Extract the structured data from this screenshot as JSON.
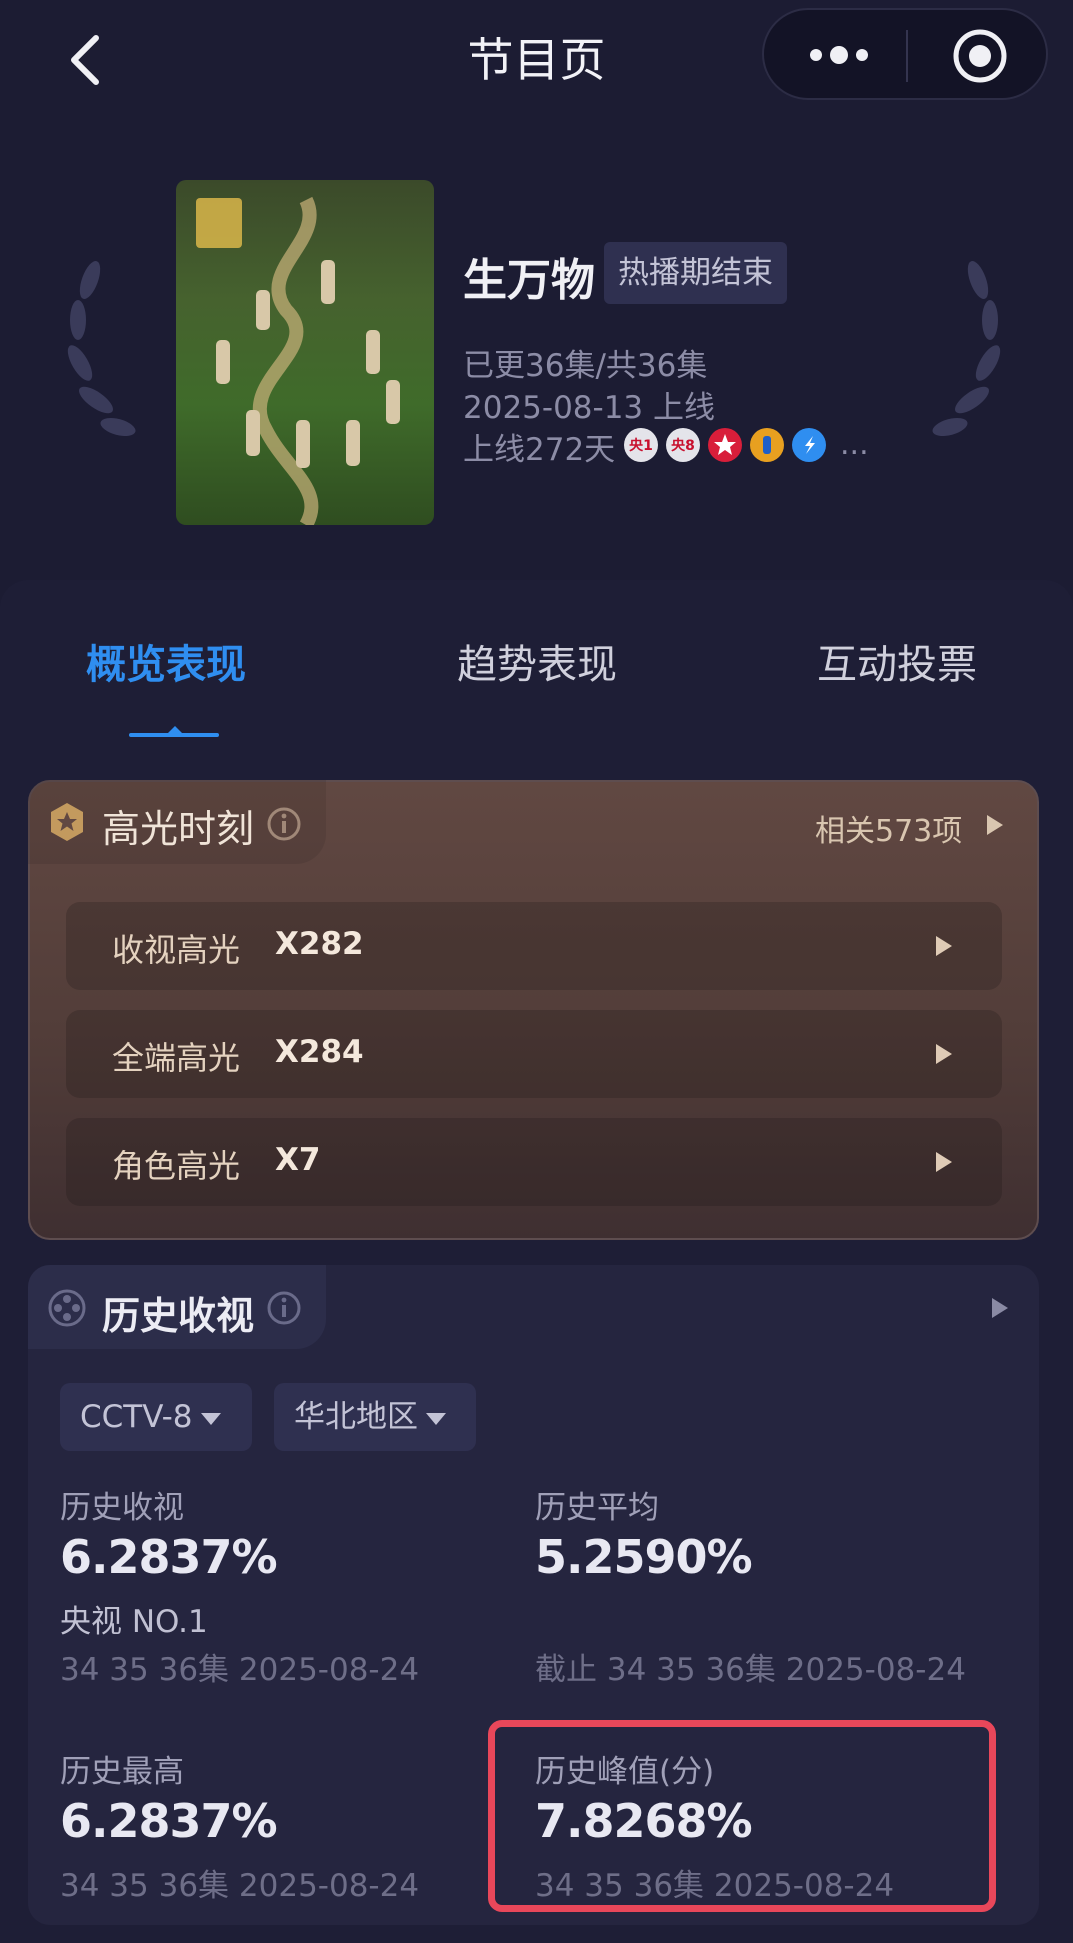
{
  "nav": {
    "title": "节目页",
    "back_icon": "back-chevron-icon",
    "more_icon": "more-dots-icon",
    "close_icon": "target-icon"
  },
  "show": {
    "title": "生万物",
    "status_badge": "热播期结束",
    "episodes": "已更36集/共36集",
    "launch_date": "2025-08-13 上线",
    "days_online": "上线272天",
    "platforms": [
      {
        "label": "央1",
        "color": "#d8d8e0",
        "text_color": "#c8102e"
      },
      {
        "label": "央8",
        "color": "#d8d8e0",
        "text_color": "#c8102e"
      },
      {
        "label": "",
        "color": "#d81e3a",
        "text_color": "#ffffff"
      },
      {
        "label": "",
        "color": "#e8a020",
        "text_color": "#1f5fc8"
      },
      {
        "label": "",
        "color": "#2f8ef0",
        "text_color": "#ffffff"
      }
    ],
    "platforms_more": "..."
  },
  "tabs": [
    {
      "label": "概览表现",
      "active": true
    },
    {
      "label": "趋势表现",
      "active": false
    },
    {
      "label": "互动投票",
      "active": false
    }
  ],
  "highlights": {
    "title": "高光时刻",
    "related": "相关573项",
    "rows": [
      {
        "label": "收视高光",
        "value": "X282"
      },
      {
        "label": "全端高光",
        "value": "X284"
      },
      {
        "label": "角色高光",
        "value": "X7"
      }
    ]
  },
  "history": {
    "title": "历史收视",
    "filters": {
      "channel": "CCTV-8",
      "region": "华北地区"
    },
    "stats": {
      "history_rating": {
        "label": "历史收视",
        "value": "6.2837%",
        "rank": "央视 NO.1",
        "sub": "34 35 36集 2025-08-24"
      },
      "history_average": {
        "label": "历史平均",
        "value": "5.2590%",
        "sub": "截止 34 35 36集 2025-08-24"
      },
      "history_max": {
        "label": "历史最高",
        "value": "6.2837%",
        "sub": "34 35 36集 2025-08-24"
      },
      "history_peak": {
        "label": "历史峰值(分)",
        "value": "7.8268%",
        "sub": "34 35 36集 2025-08-24"
      }
    }
  },
  "colors": {
    "accent": "#2f8ef0",
    "highlight_border": "#e8475a"
  }
}
